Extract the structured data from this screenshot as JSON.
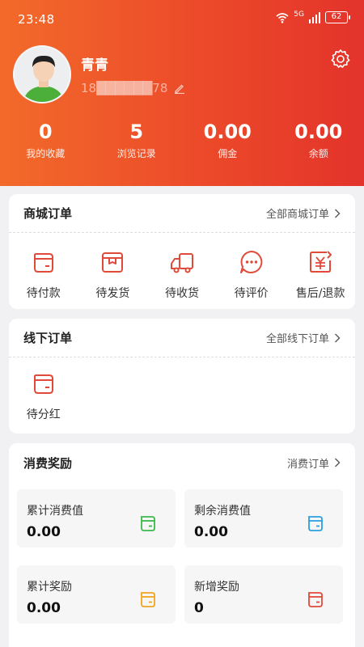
{
  "status_bar": {
    "time": "23:48",
    "network": "5G",
    "battery": "62"
  },
  "profile": {
    "name": "青青",
    "phone": "18██████78"
  },
  "stats": [
    {
      "value": "0",
      "label": "我的收藏"
    },
    {
      "value": "5",
      "label": "浏览记录"
    },
    {
      "value": "0.00",
      "label": "佣金"
    },
    {
      "value": "0.00",
      "label": "余额"
    }
  ],
  "mall_orders": {
    "title": "商城订单",
    "link": "全部商城订单",
    "items": [
      {
        "label": "待付款",
        "icon": "wallet-icon"
      },
      {
        "label": "待发货",
        "icon": "package-icon"
      },
      {
        "label": "待收货",
        "icon": "truck-icon"
      },
      {
        "label": "待评价",
        "icon": "chat-bubble-icon"
      },
      {
        "label": "售后/退款",
        "icon": "refund-icon"
      }
    ]
  },
  "offline_orders": {
    "title": "线下订单",
    "link": "全部线下订单",
    "items": [
      {
        "label": "待分红",
        "icon": "wallet-icon"
      }
    ]
  },
  "rewards": {
    "title": "消费奖励",
    "link": "消费订单",
    "tiles": [
      {
        "label": "累计消费值",
        "value": "0.00",
        "icon_color": "#3cb84a"
      },
      {
        "label": "剩余消费值",
        "value": "0.00",
        "icon_color": "#2b9fe0"
      },
      {
        "label": "累计奖励",
        "value": "0.00",
        "icon_color": "#f2a51c"
      },
      {
        "label": "新增奖励",
        "value": "0",
        "icon_color": "#e04a3a"
      }
    ]
  },
  "colors": {
    "accent": "#ec4a2a",
    "icon_red": "#e04a3a"
  }
}
